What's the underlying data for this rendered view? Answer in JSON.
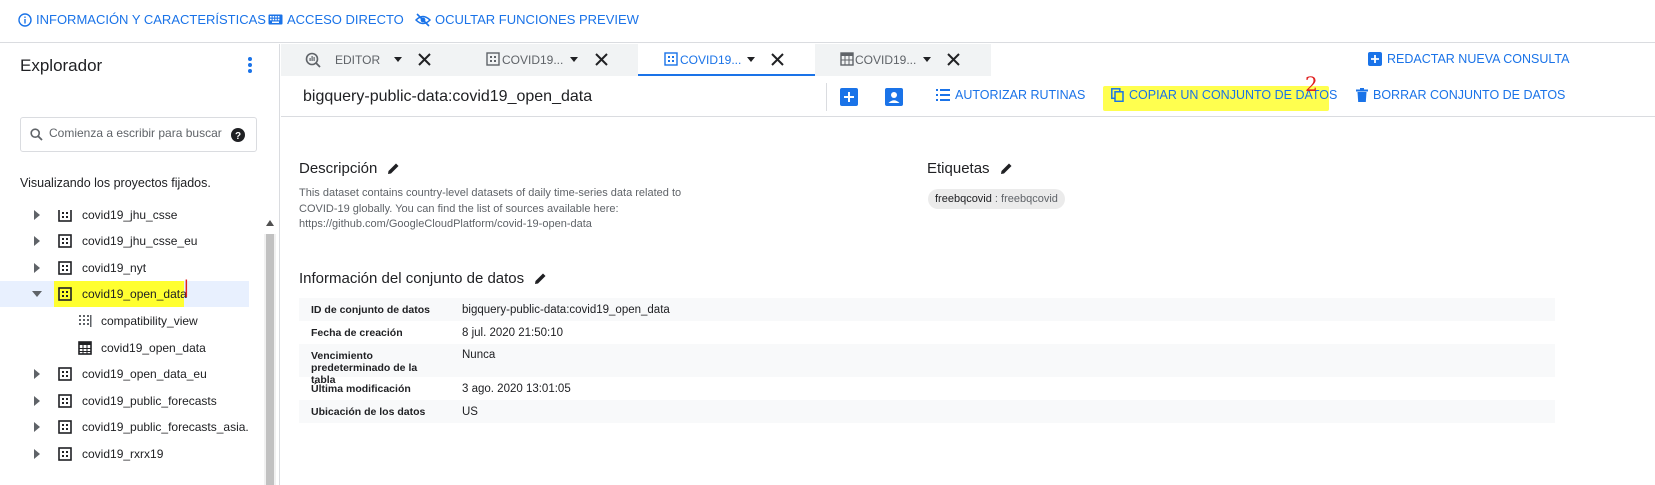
{
  "topbar": {
    "info_label": "INFORMACIÓN Y CARACTERÍSTICAS",
    "shortcuts_label": "ACCESO DIRECTO",
    "hide_preview_label": "OCULTAR FUNCIONES PREVIEW"
  },
  "explorer": {
    "title": "Explorador",
    "search_placeholder": "Comienza a escribir para buscar",
    "pinned_text": "Visualizando los proyectos fijados.",
    "items": [
      {
        "label": "covid19_jhu_csse"
      },
      {
        "label": "covid19_jhu_csse_eu"
      },
      {
        "label": "covid19_nyt"
      },
      {
        "label": "covid19_open_data"
      },
      {
        "label": "compatibility_view"
      },
      {
        "label": "covid19_open_data"
      },
      {
        "label": "covid19_open_data_eu"
      },
      {
        "label": "covid19_public_forecasts"
      },
      {
        "label": "covid19_public_forecasts_asia..."
      },
      {
        "label": "covid19_rxrx19"
      }
    ]
  },
  "tabs": [
    {
      "label": "EDITOR"
    },
    {
      "label": "COVID19..."
    },
    {
      "label": "COVID19..."
    },
    {
      "label": "COVID19..."
    }
  ],
  "compose_label": "REDACTAR NUEVA CONSULTA",
  "dataset": {
    "title": "bigquery-public-data:covid19_open_data",
    "authorize_label": "AUTORIZAR RUTINAS",
    "copy_label": "COPIAR UN CONJUNTO DE DATOS",
    "delete_label": "BORRAR CONJUNTO DE DATOS"
  },
  "annotations": {
    "mark_1": "|",
    "mark_2": "2",
    "highlight_color": "#ffff30"
  },
  "description": {
    "heading": "Descripción",
    "lines": [
      "This dataset contains country-level datasets of daily time-series data related to",
      "COVID-19 globally. You can find the list of sources available here:",
      "https://github.com/GoogleCloudPlatform/covid-19-open-data"
    ]
  },
  "labels": {
    "heading": "Etiquetas",
    "chip_key": "freebqcovid",
    "chip_sep": " : ",
    "chip_value": "freebqcovid"
  },
  "info": {
    "heading": "Información del conjunto de datos",
    "rows": [
      {
        "key": "ID de conjunto de datos",
        "value": "bigquery-public-data:covid19_open_data"
      },
      {
        "key": "Fecha de creación",
        "value": "8 jul. 2020 21:50:10"
      },
      {
        "key": "Vencimiento predeterminado de la tabla",
        "value": "Nunca"
      },
      {
        "key": "Última modificación",
        "value": "3 ago. 2020 13:01:05"
      },
      {
        "key": "Ubicación de los datos",
        "value": "US"
      }
    ]
  },
  "colors": {
    "accent": "#1a73e8",
    "selected_row": "#e8f0fe",
    "highlight": "#ffff30",
    "annotation": "#e02020"
  }
}
